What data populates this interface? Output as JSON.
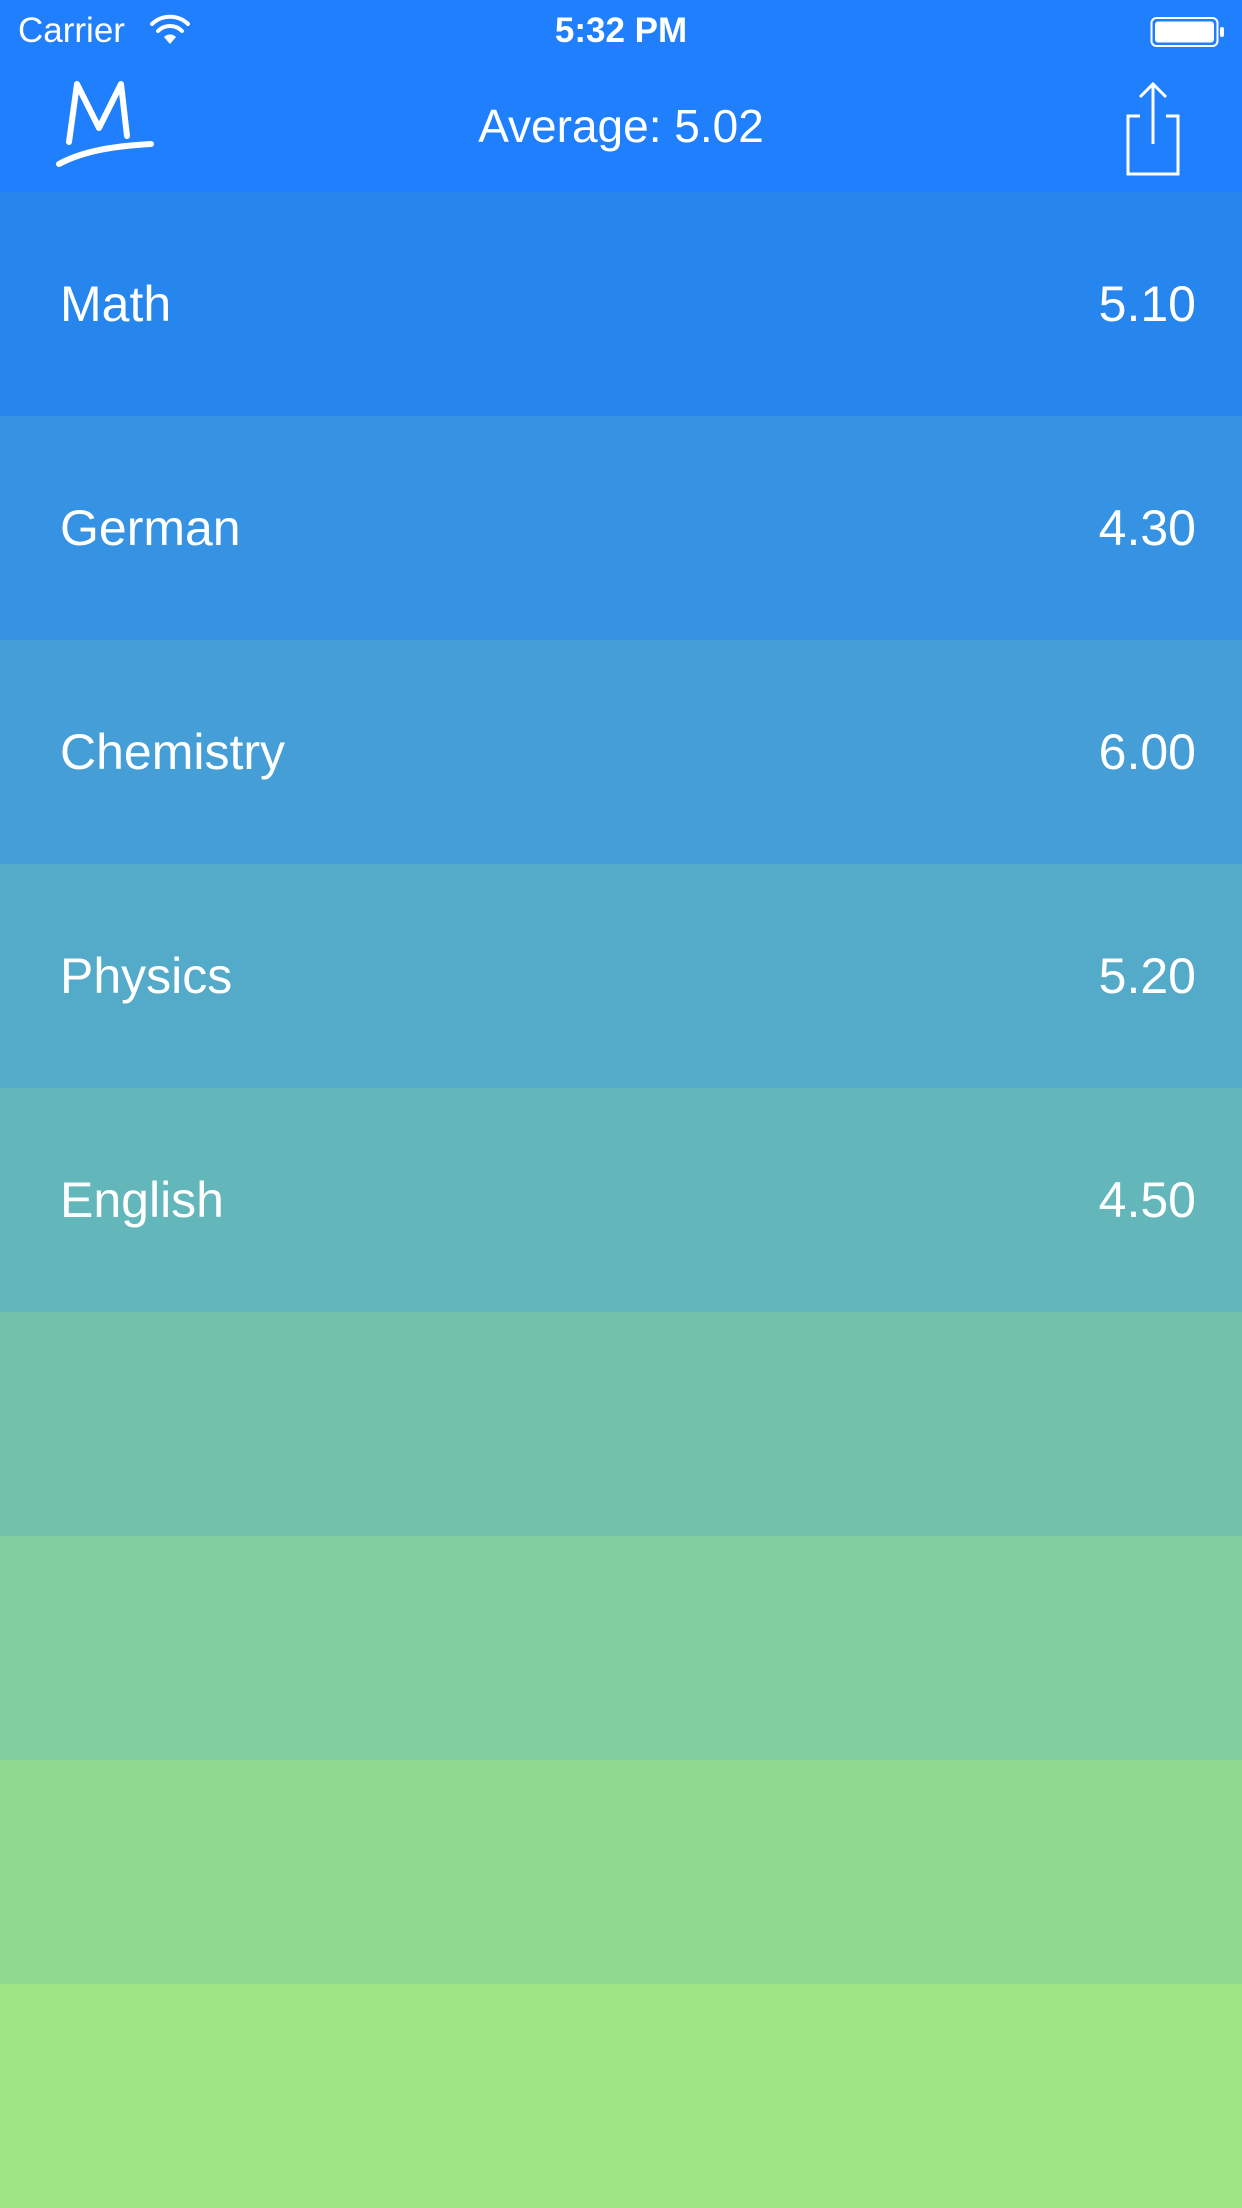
{
  "status_bar": {
    "carrier": "Carrier",
    "time": "5:32 PM",
    "wifi_icon": "wifi-icon",
    "battery_icon": "battery-icon"
  },
  "nav": {
    "logo_icon": "m-logo-icon",
    "title": "Average: 5.02",
    "share_icon": "share-icon"
  },
  "colors": {
    "nav_background": "#1f7ffd",
    "text": "#ffffff"
  },
  "subjects": [
    {
      "name": "Math",
      "grade": "5.10",
      "color": "#2785ee"
    },
    {
      "name": "German",
      "grade": "4.30",
      "color": "#3692e2"
    },
    {
      "name": "Chemistry",
      "grade": "6.00",
      "color": "#459fd6"
    },
    {
      "name": "Physics",
      "grade": "5.20",
      "color": "#54aac9"
    },
    {
      "name": "English",
      "grade": "4.50",
      "color": "#63b6b9"
    },
    {
      "name": "",
      "grade": "",
      "color": "#72c2aa"
    },
    {
      "name": "",
      "grade": "",
      "color": "#80cd9d"
    },
    {
      "name": "",
      "grade": "",
      "color": "#8fd990"
    },
    {
      "name": "",
      "grade": "",
      "color": "#9fe585"
    }
  ]
}
